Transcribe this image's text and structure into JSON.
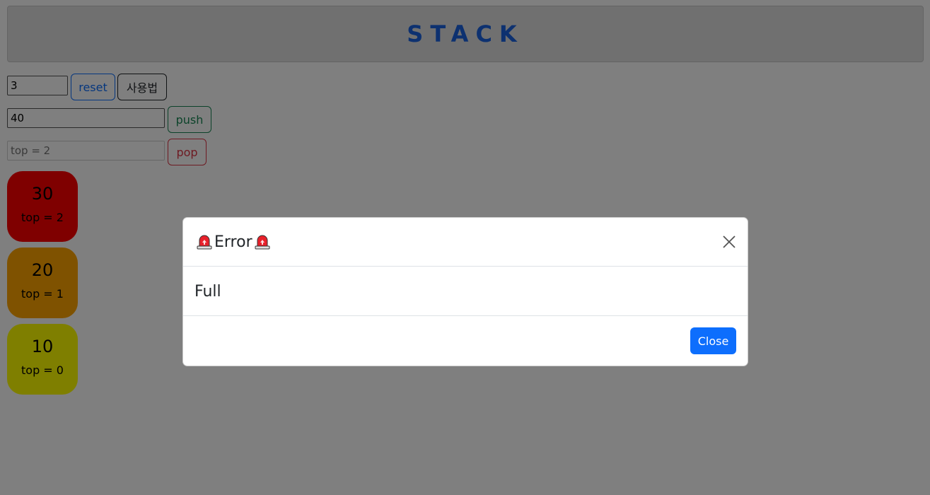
{
  "header": {
    "title": "STACK"
  },
  "controls": {
    "size_value": "3",
    "reset_label": "reset",
    "help_label": "사용법",
    "push_value": "40",
    "push_label": "push",
    "top_display": "top = 2",
    "pop_label": "pop"
  },
  "stack": [
    {
      "value": "30",
      "top_label": "top = 2",
      "color": "#ff0000"
    },
    {
      "value": "20",
      "top_label": "top = 1",
      "color": "#ffa500"
    },
    {
      "value": "10",
      "top_label": "top = 0",
      "color": "#ffff00"
    }
  ],
  "modal": {
    "title": "Error",
    "title_icon": "siren-icon",
    "body": "Full",
    "close_label": "Close",
    "close_icon": "close-icon"
  },
  "colors": {
    "accent": "#0d6efd",
    "header_title": "#1a63e0",
    "backdrop": "rgba(0,0,0,0.5)"
  }
}
